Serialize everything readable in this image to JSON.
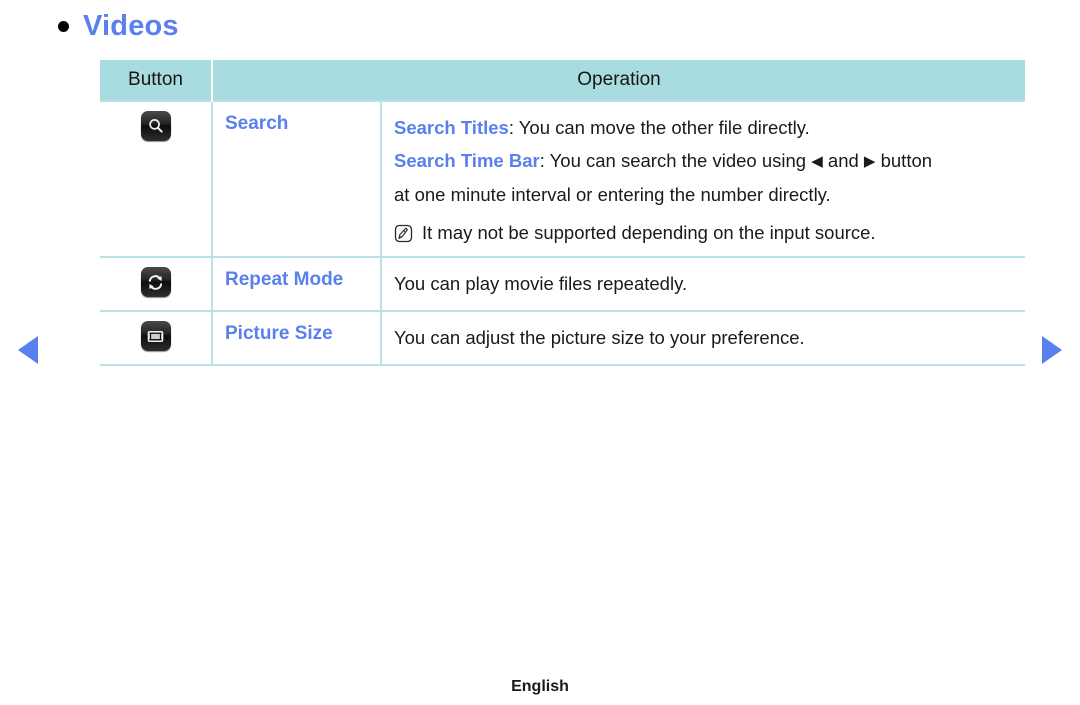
{
  "heading": {
    "bullet_icon": "bullet-dot-icon",
    "title": "Videos"
  },
  "table": {
    "headers": {
      "button": "Button",
      "operation": "Operation"
    },
    "rows": [
      {
        "icon": "search-key-icon",
        "label": "Search",
        "operation": {
          "lines": [
            {
              "term": "Search Titles",
              "rest": ": You can move the other file directly."
            },
            {
              "term": "Search Time Bar",
              "rest_a": ": You can search the video using ",
              "arrow_left": "◀",
              "rest_b": " and ",
              "arrow_right": "▶",
              "rest_c": " button"
            },
            {
              "term": "",
              "rest": "at one minute interval or entering the number directly."
            }
          ],
          "note": {
            "icon": "note-pencil-icon",
            "text": "It may not be supported depending on the input source."
          }
        }
      },
      {
        "icon": "repeat-key-icon",
        "label": "Repeat Mode",
        "operation": {
          "lines": [
            {
              "term": "",
              "rest": "You can play movie files repeatedly."
            }
          ]
        }
      },
      {
        "icon": "picture-size-key-icon",
        "label": "Picture Size",
        "operation": {
          "lines": [
            {
              "term": "",
              "rest": "You can adjust the picture size to your preference."
            }
          ]
        }
      }
    ]
  },
  "navigation": {
    "prev_icon": "triangle-left-icon",
    "next_icon": "triangle-right-icon"
  },
  "footer": {
    "language": "English"
  },
  "colors": {
    "accent_blue": "#5a80ee",
    "header_bg": "#a8dce0",
    "border": "#b7e2e6",
    "text": "#1a1a1a"
  }
}
